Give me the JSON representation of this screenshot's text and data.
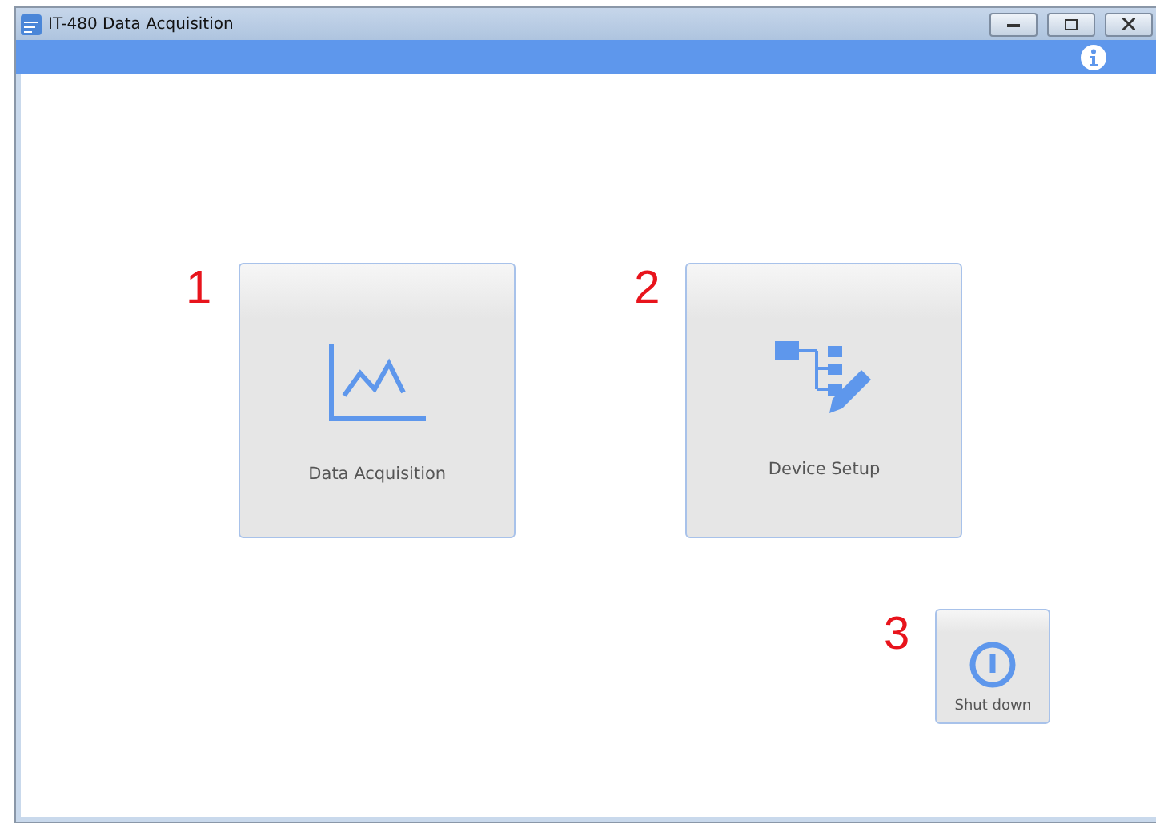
{
  "window": {
    "title": "IT-480 Data Acquisition"
  },
  "tiles": [
    {
      "number": "1",
      "label": "Data Acquisition",
      "kind": "chart"
    },
    {
      "number": "2",
      "label": "Device Setup",
      "kind": "setup"
    }
  ],
  "shutdown": {
    "number": "3",
    "label": "Shut down"
  }
}
